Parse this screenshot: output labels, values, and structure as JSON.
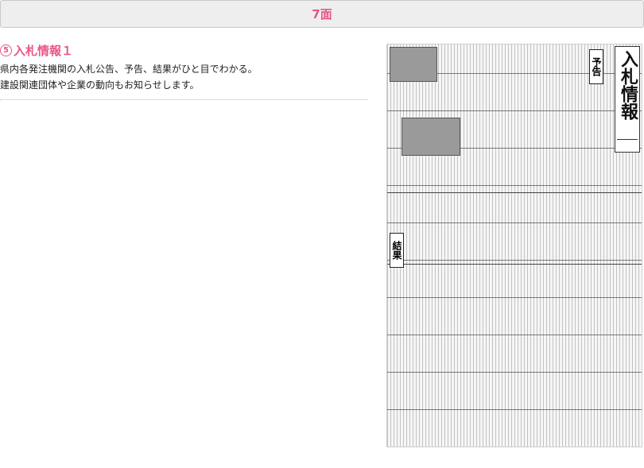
{
  "header": {
    "title": "7面"
  },
  "section": {
    "number": "⑤",
    "title": "入札情報１",
    "desc_line1": "県内各発注機関の入札公告、予告、結果がひと目でわかる。",
    "desc_line2": "建設関連団体や企業の動向もお知らせします。"
  },
  "newspaper": {
    "masthead": "入札情報",
    "tag_yokoku": "予告",
    "tag_kekka": "結果"
  },
  "colors": {
    "accent": "#e8558a",
    "header_bg": "#eeeeee"
  }
}
